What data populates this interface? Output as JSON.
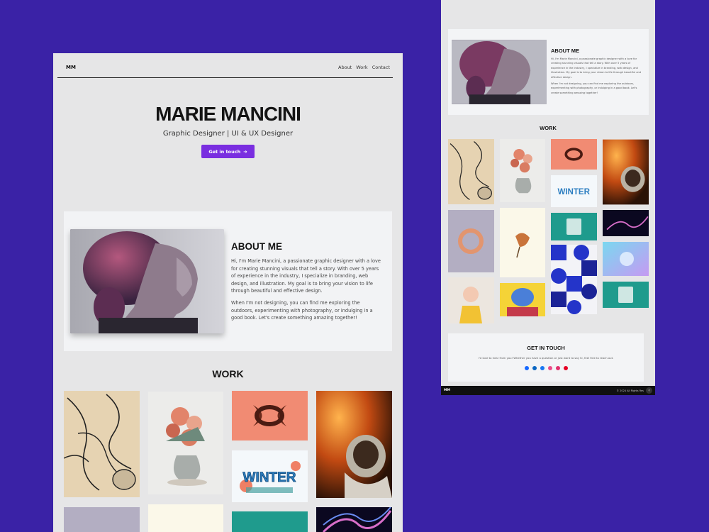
{
  "desktop": {
    "nav": {
      "logo": "MM",
      "links": [
        "About",
        "Work",
        "Contact"
      ]
    },
    "hero": {
      "name": "MARIE MANCINI",
      "subtitle": "Graphic Designer | UI & UX Designer",
      "cta_label": "Get in touch",
      "cta_icon": "arrow-right-icon"
    },
    "about": {
      "title": "ABOUT ME",
      "paragraph1": "Hi, I'm Marie Mancini, a passionate graphic designer with a love for creating stunning visuals that tell a story. With over 5 years of experience in the industry, I specialize in branding, web design, and illustration. My goal is to bring your vision to life through beautiful and effective design.",
      "paragraph2": "When I'm not designing, you can find me exploring the outdoors, experimenting with photography, or indulging in a good book. Let's create something amazing together!"
    },
    "work": {
      "title": "WORK"
    }
  },
  "mobile": {
    "about": {
      "title": "ABOUT ME",
      "paragraph1": "Hi, I'm Marie Mancini, a passionate graphic designer with a love for creating stunning visuals that tell a story. With over 5 years of experience in the industry, I specialize in branding, web design, and illustration. My goal is to bring your vision to life through beautiful and effective design.",
      "paragraph2": "When I'm not designing, you can find me exploring the outdoors, experimenting with photography, or indulging in a good book. Let's create something amazing together!"
    },
    "work": {
      "title": "WORK"
    },
    "contact": {
      "title": "GET IN TOUCH",
      "text": "I'd love to hear from you! Whether you have a question or just want to say hi, feel free to reach out.",
      "socials": [
        "behance-icon",
        "linkedin-icon",
        "facebook-icon",
        "dribbble-icon",
        "instagram-icon",
        "pinterest-icon"
      ]
    },
    "footer": {
      "logo": "MM",
      "copyright": "© 2024 All Rights Res",
      "back_icon": "chevron-left-icon"
    }
  },
  "colors": {
    "background": "#3a22a6",
    "accent": "#7a2ee0",
    "page": "#e6e6e7",
    "card": "#f2f3f5",
    "footer": "#101010"
  }
}
